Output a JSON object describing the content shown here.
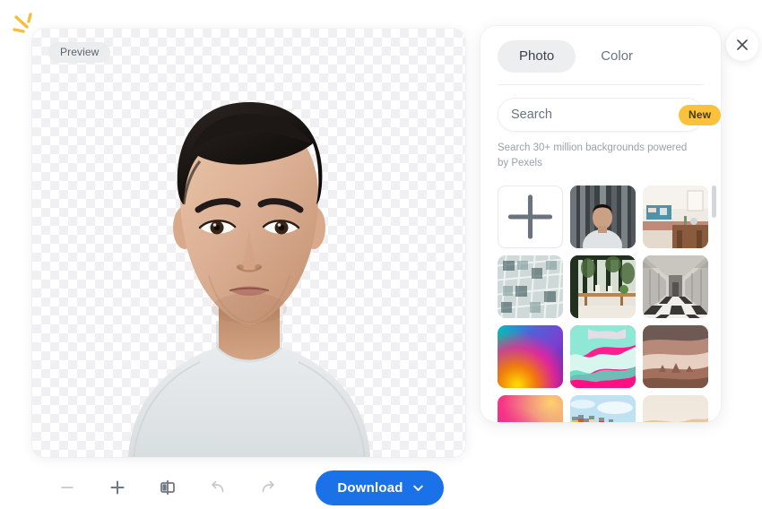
{
  "canvas": {
    "preview_badge": "Preview",
    "subject_description": "portrait-cutout-person"
  },
  "toolbar": {
    "zoom_out_label": "−",
    "zoom_in_label": "+",
    "compare_label": "compare",
    "undo_label": "undo",
    "redo_label": "redo",
    "download_label": "Download"
  },
  "panel": {
    "tabs": [
      {
        "label": "Photo",
        "active": true
      },
      {
        "label": "Color",
        "active": false
      }
    ],
    "search": {
      "placeholder": "Search",
      "value": "",
      "badge": "New",
      "hint": "Search 30+ million backgrounds powered by Pexels"
    },
    "thumbnails": [
      {
        "name": "add-background",
        "kind": "add",
        "label": "+"
      },
      {
        "name": "thumb-portrait-curtain",
        "kind": "image"
      },
      {
        "name": "thumb-cafe-interior",
        "kind": "image"
      },
      {
        "name": "thumb-glass-facade",
        "kind": "image"
      },
      {
        "name": "thumb-greenhouse-table",
        "kind": "image"
      },
      {
        "name": "thumb-checkered-corridor",
        "kind": "image"
      },
      {
        "name": "thumb-rainbow-gradient",
        "kind": "image"
      },
      {
        "name": "thumb-pink-teal-marble",
        "kind": "image"
      },
      {
        "name": "thumb-desert-canyon",
        "kind": "image"
      },
      {
        "name": "thumb-pink-orange-gradient",
        "kind": "image"
      },
      {
        "name": "thumb-beach-huts",
        "kind": "image"
      },
      {
        "name": "thumb-sand-dunes",
        "kind": "image"
      }
    ]
  },
  "close": {
    "label": "×"
  },
  "colors": {
    "accent_blue": "#1b72e8",
    "badge_yellow": "#f9c13c",
    "tab_active_bg": "#eceef0",
    "sparkle": "#f7bd3b"
  }
}
